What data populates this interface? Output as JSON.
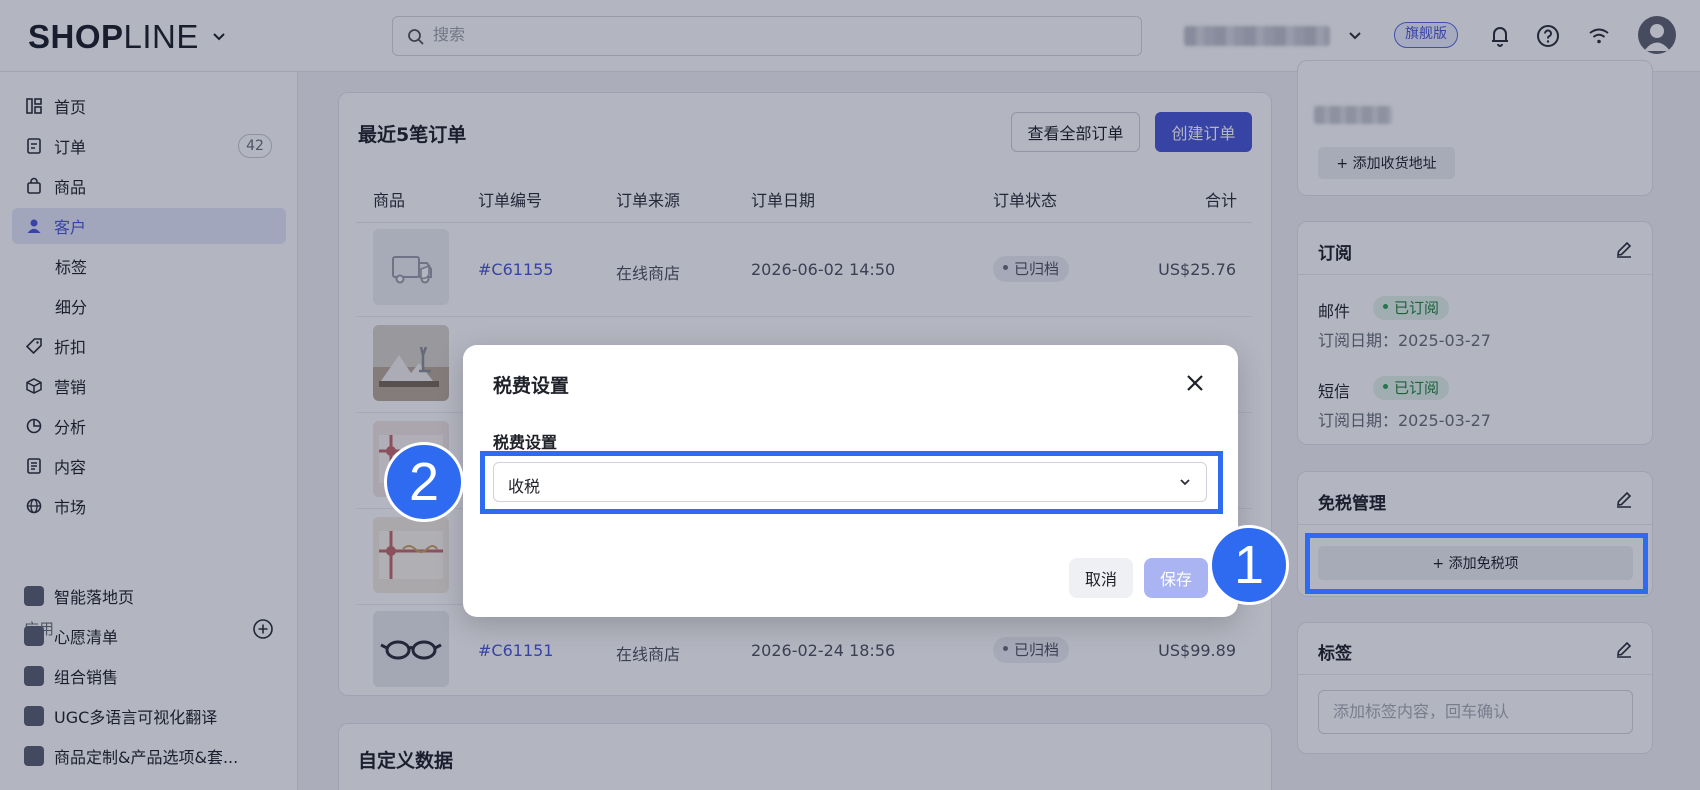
{
  "topbar": {
    "logo_bold": "SHOP",
    "logo_thin": "LINE",
    "search_placeholder": "搜索",
    "plan_badge": "旗舰版"
  },
  "sidebar": {
    "items": [
      {
        "label": "首页",
        "icon": "dashboard-icon"
      },
      {
        "label": "订单",
        "icon": "order-icon",
        "count": "42"
      },
      {
        "label": "商品",
        "icon": "bag-icon"
      },
      {
        "label": "客户",
        "icon": "user-icon",
        "active": true
      },
      {
        "label": "标签",
        "sub": true
      },
      {
        "label": "细分",
        "sub": true
      },
      {
        "label": "折扣",
        "icon": "tag-icon"
      },
      {
        "label": "营销",
        "icon": "cube-icon"
      },
      {
        "label": "分析",
        "icon": "pie-icon"
      },
      {
        "label": "内容",
        "icon": "doc-icon"
      },
      {
        "label": "市场",
        "icon": "globe-icon"
      }
    ],
    "apps_label": "应用",
    "apps": [
      {
        "label": "智能落地页"
      },
      {
        "label": "心愿清单"
      },
      {
        "label": "组合销售"
      },
      {
        "label": "UGC多语言可视化翻译"
      },
      {
        "label": "商品定制&产品选项&套..."
      }
    ]
  },
  "orders_card": {
    "title": "最近5笔订单",
    "view_all": "查看全部订单",
    "create": "创建订单",
    "columns": [
      "商品",
      "订单编号",
      "订单来源",
      "订单日期",
      "订单状态",
      "合计"
    ],
    "rows": [
      {
        "id": "#C61155",
        "source": "在线商店",
        "date": "2026-06-02 14:50",
        "status": "已归档",
        "total": "US$25.76"
      },
      {
        "id": "#C61151",
        "source": "在线商店",
        "date": "2026-02-24 18:56",
        "status": "已归档",
        "total": "US$99.89"
      }
    ]
  },
  "custom_data_card": {
    "title": "自定义数据"
  },
  "right_panel": {
    "add_address": "+ 添加收货地址",
    "subscription": {
      "title": "订阅",
      "email_label": "邮件",
      "email_status": "已订阅",
      "email_date": "订阅日期：2025-03-27",
      "sms_label": "短信",
      "sms_status": "已订阅",
      "sms_date": "订阅日期：2025-03-27"
    },
    "tax_exempt": {
      "title": "免税管理",
      "add_button": "+ 添加免税项"
    },
    "tags": {
      "title": "标签",
      "placeholder": "添加标签内容，回车确认"
    }
  },
  "modal": {
    "title": "税费设置",
    "field_label": "税费设置",
    "selected": "收税",
    "cancel": "取消",
    "save": "保存"
  },
  "annotations": {
    "step1": "1",
    "step2": "2"
  },
  "colors": {
    "accent": "#4a59d8",
    "annotation": "#2f6bf0"
  }
}
